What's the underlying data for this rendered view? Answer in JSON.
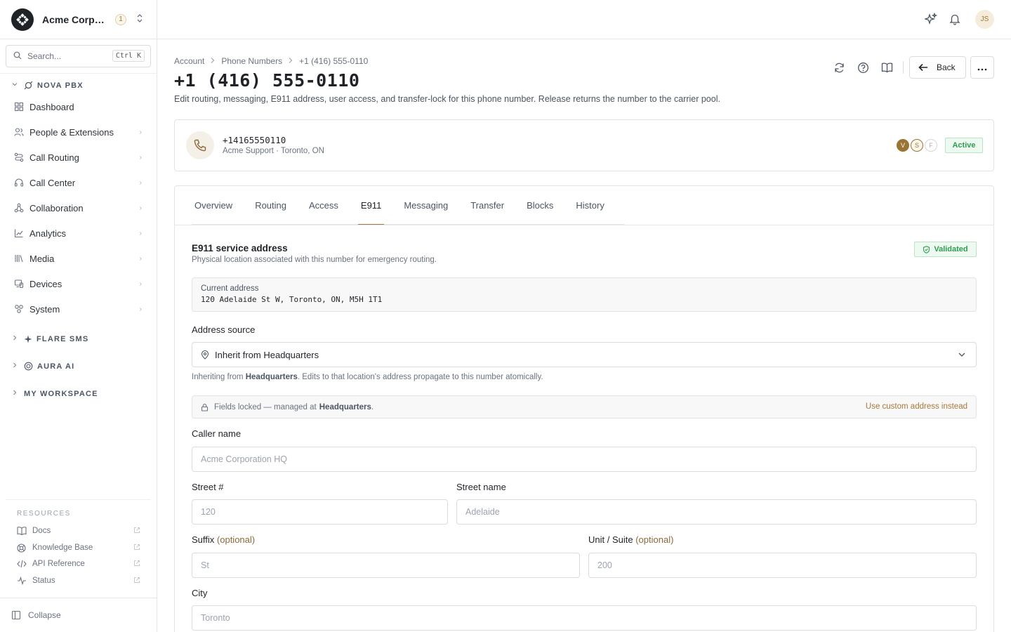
{
  "org": {
    "name": "Acme Corporation",
    "notification_count": "1"
  },
  "search": {
    "placeholder": "Search...",
    "shortcut": "Ctrl K"
  },
  "groups": {
    "nova": "NOVA PBX",
    "flare": "FLARE SMS",
    "aura": "AURA AI",
    "workspace": "MY WORKSPACE"
  },
  "nav": [
    {
      "label": "Dashboard",
      "icon": "grid-icon"
    },
    {
      "label": "People & Extensions",
      "icon": "people-icon"
    },
    {
      "label": "Call Routing",
      "icon": "routing-icon"
    },
    {
      "label": "Call Center",
      "icon": "headset-icon"
    },
    {
      "label": "Collaboration",
      "icon": "collaboration-icon"
    },
    {
      "label": "Analytics",
      "icon": "chart-icon"
    },
    {
      "label": "Media",
      "icon": "media-icon"
    },
    {
      "label": "Devices",
      "icon": "devices-icon"
    },
    {
      "label": "System",
      "icon": "system-icon"
    }
  ],
  "resources": {
    "heading": "RESOURCES",
    "items": [
      {
        "label": "Docs",
        "icon": "book-icon"
      },
      {
        "label": "Knowledge Base",
        "icon": "lifebuoy-icon"
      },
      {
        "label": "API Reference",
        "icon": "code-icon"
      },
      {
        "label": "Status",
        "icon": "pulse-icon"
      }
    ]
  },
  "collapse_label": "Collapse",
  "user": {
    "initials": "JS"
  },
  "breadcrumb": [
    "Account",
    "Phone Numbers",
    "+1 (416) 555-0110"
  ],
  "page": {
    "title": "+1 (416) 555-0110",
    "description": "Edit routing, messaging, E911 address, user access, and transfer-lock for this phone number. Release returns the number to the carrier pool.",
    "back_label": "Back"
  },
  "number_card": {
    "number": "+14165550110",
    "subtitle": "Acme Support · Toronto, ON",
    "capabilities": [
      "V",
      "S",
      "F"
    ],
    "status": "Active"
  },
  "tabs": [
    "Overview",
    "Routing",
    "Access",
    "E911",
    "Messaging",
    "Transfer",
    "Blocks",
    "History"
  ],
  "active_tab": "E911",
  "e911": {
    "title": "E911 service address",
    "subtitle": "Physical location associated with this number for emergency routing.",
    "status": "Validated",
    "current_address_label": "Current address",
    "current_address": "120 Adelaide St W, Toronto, ON, M5H 1T1",
    "address_source_label": "Address source",
    "address_source_value": "Inherit from Headquarters",
    "inherit_note_prefix": "Inheriting from",
    "inherit_note_location": "Headquarters",
    "inherit_note_suffix": ". Edits to that location's address propagate to this number atomically.",
    "locked_prefix": "Fields locked — managed at",
    "locked_location": "Headquarters",
    "locked_suffix": ".",
    "custom_link": "Use custom address instead",
    "optional_tag": "(optional)",
    "fields": {
      "caller_name": {
        "label": "Caller name",
        "placeholder": "Acme Corporation HQ"
      },
      "street_number": {
        "label": "Street #",
        "placeholder": "120"
      },
      "street_name": {
        "label": "Street name",
        "placeholder": "Adelaide"
      },
      "suffix": {
        "label": "Suffix",
        "placeholder": "St"
      },
      "unit": {
        "label": "Unit / Suite",
        "placeholder": "200"
      },
      "city": {
        "label": "City",
        "placeholder": "Toronto"
      }
    }
  },
  "colors": {
    "accent": "#a8793a",
    "success": "#2e9e50",
    "border": "#e3e3e3"
  }
}
